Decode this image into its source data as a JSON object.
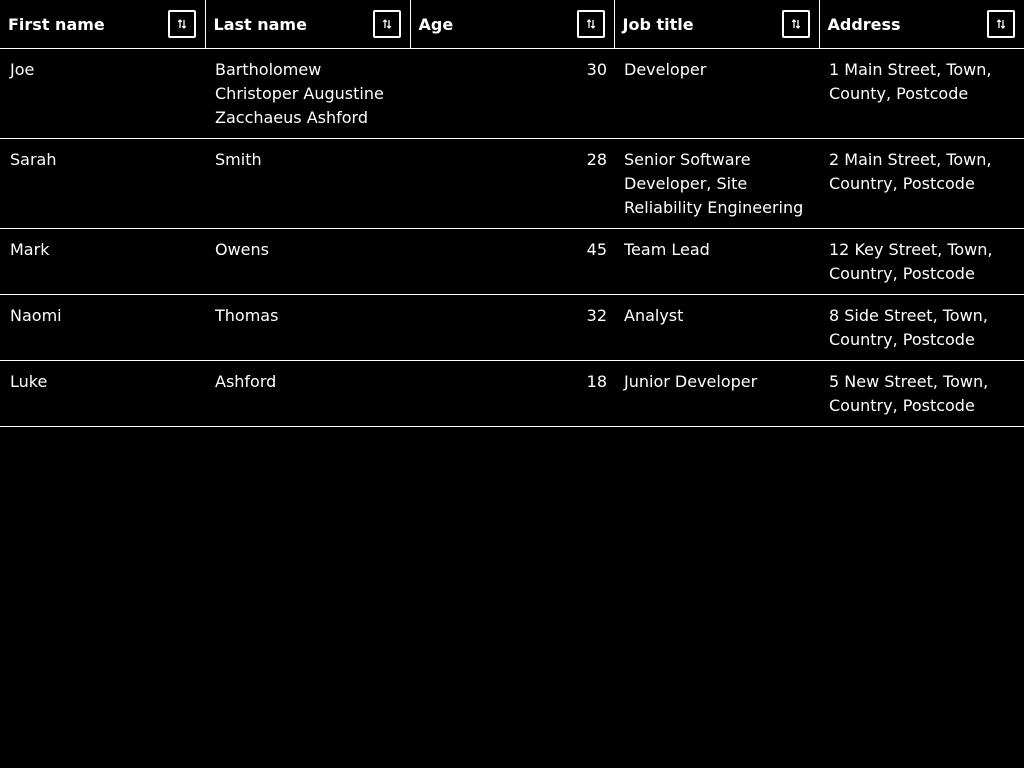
{
  "columns": [
    {
      "label": "First name",
      "sort_icon": "sort-arrows-icon"
    },
    {
      "label": "Last name",
      "sort_icon": "sort-arrows-icon"
    },
    {
      "label": "Age",
      "sort_icon": "sort-arrows-icon"
    },
    {
      "label": "Job title",
      "sort_icon": "sort-arrows-icon"
    },
    {
      "label": "Address",
      "sort_icon": "sort-arrows-icon"
    }
  ],
  "rows": [
    {
      "first": "Joe",
      "last": "Bartholomew Christoper Augustine Zacchaeus Ashford",
      "age": "30",
      "job": "Developer",
      "address": "1 Main Street, Town, County, Postcode"
    },
    {
      "first": "Sarah",
      "last": "Smith",
      "age": "28",
      "job": "Senior Software Developer, Site Reliability Engineering",
      "address": "2 Main Street, Town, Country, Postcode"
    },
    {
      "first": "Mark",
      "last": "Owens",
      "age": "45",
      "job": "Team Lead",
      "address": "12 Key Street, Town, Country, Postcode"
    },
    {
      "first": "Naomi",
      "last": "Thomas",
      "age": "32",
      "job": "Analyst",
      "address": "8 Side Street, Town, Country, Postcode"
    },
    {
      "first": "Luke",
      "last": "Ashford",
      "age": "18",
      "job": "Junior Developer",
      "address": "5 New Street, Town, Country, Postcode"
    }
  ],
  "colors": {
    "background": "#000000",
    "text": "#ffffff",
    "border": "#ffffff"
  }
}
